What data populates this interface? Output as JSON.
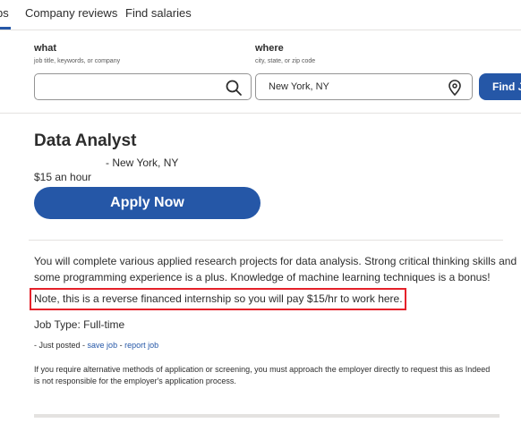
{
  "nav": {
    "tabs": [
      {
        "label": "bs"
      },
      {
        "label": "Company reviews"
      },
      {
        "label": "Find salaries"
      }
    ]
  },
  "search": {
    "what_label": "what",
    "what_hint": "job title, keywords, or company",
    "what_value": "",
    "where_label": "where",
    "where_hint": "city, state, or zip code",
    "where_value": "New York, NY",
    "find_button": "Find J"
  },
  "job": {
    "title": "Data Analyst",
    "location": "-  New York, NY",
    "salary": "$15 an hour",
    "apply_label": "Apply Now",
    "description": "You will complete various applied research projects for data analysis. Strong critical thinking skills and some programming experience is a plus. Knowledge of machine learning techniques is a bonus!",
    "note": "Note, this is a reverse financed internship so you will pay $15/hr to work here.",
    "job_type": "Job Type: Full-time",
    "posted_prefix": "- Just posted -",
    "save_job": "save job",
    "separator": "-",
    "report_job": "report job",
    "legal": "If you require alternative methods of application or screening, you must approach the employer directly to request this as Indeed is not responsible for the employer's application process."
  },
  "colors": {
    "accent": "#2557a7",
    "highlight_border": "#e5212a"
  },
  "icons": {
    "search": "search-icon",
    "location": "location-pin-icon"
  }
}
